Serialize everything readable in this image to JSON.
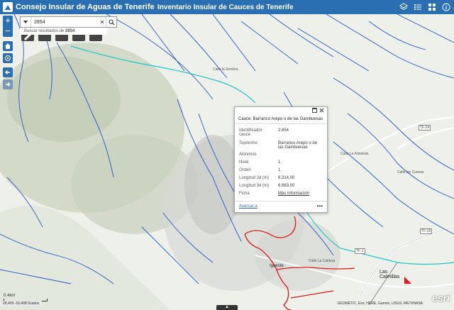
{
  "header": {
    "app_title": "Consejo Insular de Aguas de Tenerife",
    "center_title": "Inventario Insular de Cauces de Tenerife"
  },
  "search": {
    "value": "2854",
    "suggestion_prefix": "Buscar resultados de",
    "suggestion_term": "2854"
  },
  "popup": {
    "title": "Cauce: Barranco Arepo o de las Gambuesas",
    "fields": [
      {
        "label": "Identificador cauce",
        "value": "2.854"
      },
      {
        "label": "Topónimo",
        "value": "Barranco Arepo o de las Gambuesas"
      },
      {
        "label": "Alónimos",
        "value": ""
      },
      {
        "label": "Nivel",
        "value": "1"
      },
      {
        "label": "Orden",
        "value": "1"
      },
      {
        "label": "Longitud 2d (m)",
        "value": "6.314,00"
      },
      {
        "label": "Longitud 3d (m)",
        "value": "6.663,00"
      },
      {
        "label": "Ficha",
        "value": "Más información"
      }
    ],
    "zoom_link": "Acercar a"
  },
  "map_labels": {
    "las_caletillas": "Las Caletillas",
    "igueste": "Igueste",
    "tf28": "TF-28",
    "tf24": "TF-24",
    "tf1": "TF-1",
    "la_sombra": "Calle la Sombra",
    "la_caldera": "Calle La Caldera",
    "cuevas": "Calle las Cuevas",
    "la_arboleda": "Calle La Arboleda"
  },
  "scale_label": "0.4km",
  "coordinates": "28,409 -16,408 Grados",
  "attribution": "GEOMETIC, Esri, HERE, Garmin, USGS, METI/NASA",
  "esri_logo": "esri",
  "colors": {
    "header": "#2b6fb3",
    "stream": "#2357c9",
    "highlight_stream": "#19c6c8",
    "selected_stream": "#e01a1a",
    "terrain": "#eef0ea"
  }
}
